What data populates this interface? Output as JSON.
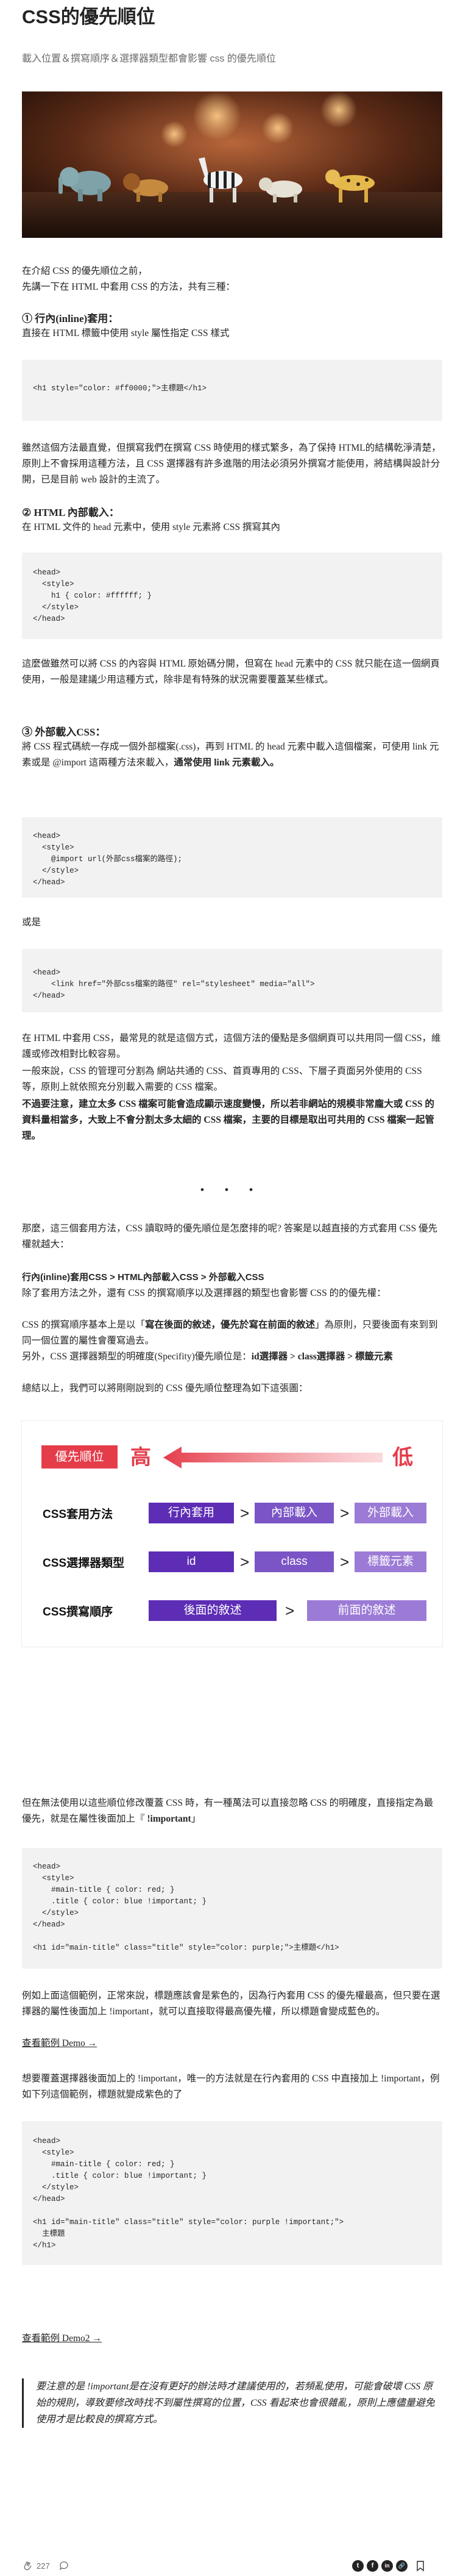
{
  "title": "CSS的優先順位",
  "subtitle": "載入位置＆撰寫順序＆選擇器類型都會影響 css 的優先順位",
  "hero_alt": "toy animals on a table",
  "intro": {
    "l1": "在介紹 CSS 的優先順位之前，",
    "l2": "先講一下在 HTML 中套用 CSS 的方法，共有三種："
  },
  "inline": {
    "heading": "① 行內(inline)套用：",
    "desc": "直接在 HTML 標籤中使用 style 屬性指定 CSS 樣式",
    "code": "<h1 style=\"color: #ff0000;\">主標題</h1>",
    "note": "雖然這個方法最直覺，但撰寫我們在撰寫 CSS 時使用的樣式繁多，為了保持 HTML的結構乾淨清楚，原則上不會採用這種方法，且 CSS 選擇器有許多進階的用法必須另外撰寫才能使用，將結構與設計分開，已是目前 web 設計的主流了。"
  },
  "internal": {
    "heading": "② HTML 內部載入：",
    "desc": "在 HTML 文件的 head 元素中，使用 style 元素將 CSS 撰寫其內",
    "code": "<head>\n  <style>\n    h1 { color: #ffffff; }\n  </style>\n</head>",
    "note": "這麼做雖然可以將 CSS 的內容與 HTML 原始碼分開，但寫在 head 元素中的 CSS 就只能在這一個網頁使用，一般是建議少用這種方式，除非是有特殊的狀況需要覆蓋某些樣式。"
  },
  "external": {
    "heading": "③ 外部載入CSS：",
    "desc_a": "將 CSS 程式碼統一存成一個外部檔案(.css)，再到 HTML 的 head 元素中載入這個檔案，可使用 link 元素或是 @import 這兩種方法來載入，",
    "desc_b": "通常使用 link 元素載入。",
    "code1": "<head>\n  <style>\n    @import url(外部css檔案的路徑);\n  </style>\n</head>",
    "or": "或是",
    "code2": "<head>\n    <link href=\"外部css檔案的路徑\" rel=\"stylesheet\" media=\"all\">\n</head>",
    "note_a": "在 HTML 中套用 CSS，最常見的就是這個方式，這個方法的優點是多個網頁可以共用同一個 CSS，維護或修改相對比較容易。",
    "note_b": "一般來說，CSS 的管理可分割為 網站共通的 CSS、首頁專用的 CSS、下層子頁面另外使用的 CSS 等，原則上就依照充分別載入需要的 CSS 檔案。",
    "note_c": "不過要注意，建立太多 CSS 檔案可能會造成顯示速度變慢，所以若非網站的規模非常龐大或 CSS 的資料量相當多，大致上不會分割太多太細的 CSS 檔案，主要的目標是取出可共用的 CSS 檔案一起管理。"
  },
  "separator": "・・・",
  "priority": {
    "intro": "那麼，這三個套用方法，CSS 讀取時的優先順位是怎麼排的呢? 答案是以越直接的方式套用 CSS 優先權就越大：",
    "order_heading": "行內(inline)套用CSS > HTML內部載入CSS > 外部載入CSS",
    "p1": "除了套用方法之外，還有 CSS 的撰寫順序以及選擇器的類型也會影響 CSS 的的優先權：",
    "p2_a": "CSS 的撰寫順序基本上是以「",
    "p2_b": "寫在後面的敘述，優先於寫在前面的敘述",
    "p2_c": "」為原則，只要後面有來到到同一個位置的屬性會覆寫過去。",
    "p3_a": "另外，CSS 選擇器類型的明確度(Specifity)優先順位是：",
    "p3_b": "id選擇器 > class選擇器 > 標籤元素",
    "p4": "總結以上，我們可以將剛剛說到的 CSS 優先順位整理為如下這張圖："
  },
  "diagram": {
    "badge": "優先順位",
    "high": "高",
    "low": "低",
    "gt": ">",
    "rows": [
      {
        "label": "CSS套用方法",
        "items": [
          "行內套用",
          "內部載入",
          "外部載入"
        ]
      },
      {
        "label": "CSS選擇器類型",
        "items": [
          "id",
          "class",
          "標籤元素"
        ]
      },
      {
        "label": "CSS撰寫順序",
        "items": [
          "後面的敘述",
          "前面的敘述"
        ]
      }
    ],
    "colors": {
      "red": "#e53c4a",
      "purple_dark": "#5d2db5",
      "purple_mid": "#7b55c6",
      "purple_light": "#9c7bd6"
    }
  },
  "important": {
    "p1_a": "但在無法使用以這些順位修改覆蓋 CSS 時，有一種萬法可以直接忽略 CSS 的明確度，直接指定為最優先，就是在屬性後面加上『",
    "p1_b": " !important",
    "p1_c": "」",
    "code1": "<head>\n  <style>\n    #main-title { color: red; }\n    .title { color: blue !important; }\n  </style>\n</head>\n\n<h1 id=\"main-title\" class=\"title\" style=\"color: purple;\">主標題</h1>",
    "p2": "例如上面這個範例，正常來說，標題應該會是紫色的，因為行內套用 CSS 的優先權最高，但只要在選擇器的屬性後面加上 !important，就可以直接取得最高優先權，所以標題會變成藍色的。",
    "link1": "查看範例 Demo →",
    "p3": "想要覆蓋選擇器後面加上的 !important，唯一的方法就是在行內套用的 CSS 中直接加上 !important，例如下列這個範例，標題就變成紫色的了",
    "code2": "<head>\n  <style>\n    #main-title { color: red; }\n    .title { color: blue !important; }\n  </style>\n</head>\n\n<h1 id=\"main-title\" class=\"title\" style=\"color: purple !important;\">\n  主標題\n</h1>",
    "link2": "查看範例 Demo2 →",
    "quote": "要注意的是 !important是在沒有更好的辦法時才建議使用的，若頻亂使用，可能會破壞 CSS 原始的規則，導致要修改時找不到屬性撰寫的位置，CSS 看起來也會很雜亂，原則上應儘量避免使用才是比較良的撰寫方式。"
  },
  "footer": {
    "claps": "227",
    "comments": "",
    "social": [
      "t",
      "f",
      "in",
      "🔗"
    ]
  }
}
